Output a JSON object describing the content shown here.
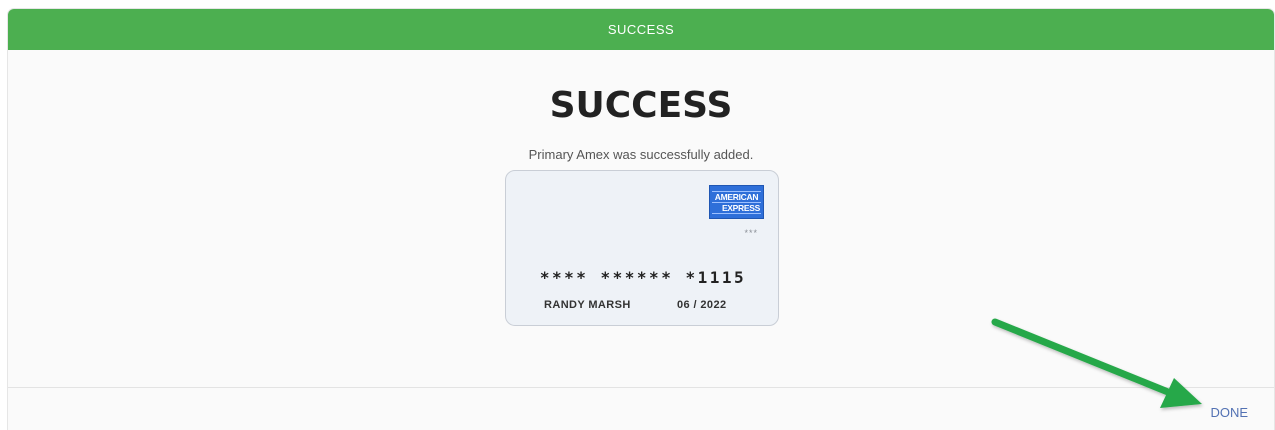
{
  "modal": {
    "header_title": "SUCCESS",
    "title": "SUCCESS",
    "message": "Primary Amex was successfully added."
  },
  "card": {
    "brand_line1": "AMERICAN",
    "brand_line2": "EXPRESS",
    "cvv_mask": "***",
    "number": "**** ****** *1115",
    "holder": "RANDY MARSH",
    "expiry": "06 / 2022"
  },
  "footer": {
    "done_label": "DONE"
  },
  "colors": {
    "header": "#4caf50",
    "link": "#5271b3",
    "annotation_arrow": "#27a84a",
    "amex_blue": "#2e6fd9"
  },
  "annotation": {
    "arrow_icon": "green-arrow-icon"
  }
}
